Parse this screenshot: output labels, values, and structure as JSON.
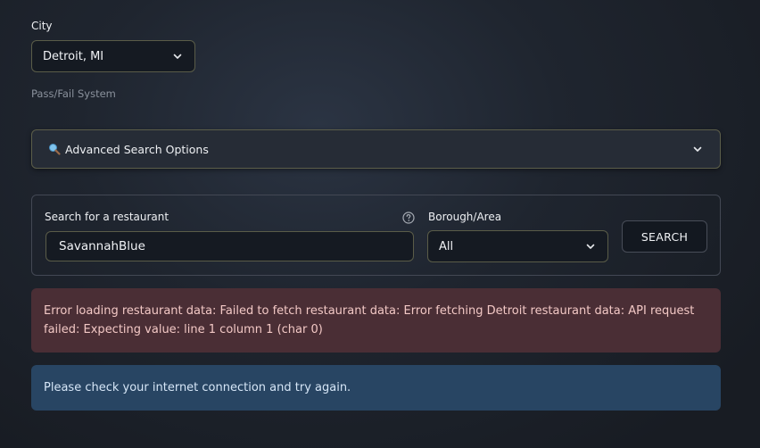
{
  "city": {
    "label": "City",
    "selected": "Detroit, MI"
  },
  "system_text": "Pass/Fail System",
  "advanced": {
    "label": "Advanced Search Options",
    "icon": "magnifier-icon"
  },
  "search": {
    "label": "Search for a restaurant",
    "value": "SavannahBlue",
    "help_icon": "help-circle-icon"
  },
  "borough": {
    "label": "Borough/Area",
    "selected": "All"
  },
  "search_button": "SEARCH",
  "alerts": {
    "error": "Error loading restaurant data: Failed to fetch restaurant data: Error fetching Detroit restaurant data: API request failed: Expecting value: line 1 column 1 (char 0)",
    "info": "Please check your internet connection and try again."
  },
  "colors": {
    "error_bg": "#4a2e35",
    "info_bg": "#284563",
    "field_border": "#5a5c48"
  }
}
